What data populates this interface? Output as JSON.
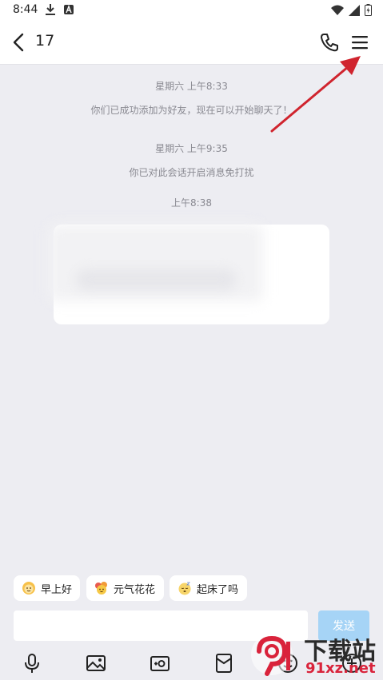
{
  "status_bar": {
    "time": "8:44",
    "icons": [
      "download-icon",
      "a-badge-icon",
      "wifi-icon",
      "signal-icon",
      "battery-icon"
    ]
  },
  "header": {
    "title": "17",
    "icons": [
      "back-icon",
      "phone-icon",
      "menu-icon"
    ]
  },
  "messages": {
    "sys1_time": "星期六 上午8:33",
    "sys1_text": "你们已成功添加为好友，现在可以开始聊天了！",
    "sys2_time": "星期六 上午9:35",
    "sys2_text": "你已对此会话开启消息免打扰",
    "sys3_time": "上午8:38"
  },
  "quick_replies": [
    {
      "label": "早上好",
      "icon": "sun-face-emoji"
    },
    {
      "label": "元气花花",
      "icon": "flower-emoji"
    },
    {
      "label": "起床了吗",
      "icon": "sleepy-face-emoji"
    }
  ],
  "composer": {
    "input_value": "",
    "send_label": "发送"
  },
  "toolbar": {
    "icons": [
      "microphone-icon",
      "image-icon",
      "camera-icon",
      "red-packet-icon",
      "emoji-icon",
      "plus-icon"
    ]
  },
  "watermark": {
    "brand": "下载站",
    "url": "91xz.net"
  },
  "colors": {
    "background": "#ededf2",
    "send_button": "#a6d4f6",
    "annotation_arrow": "#d0242e"
  }
}
